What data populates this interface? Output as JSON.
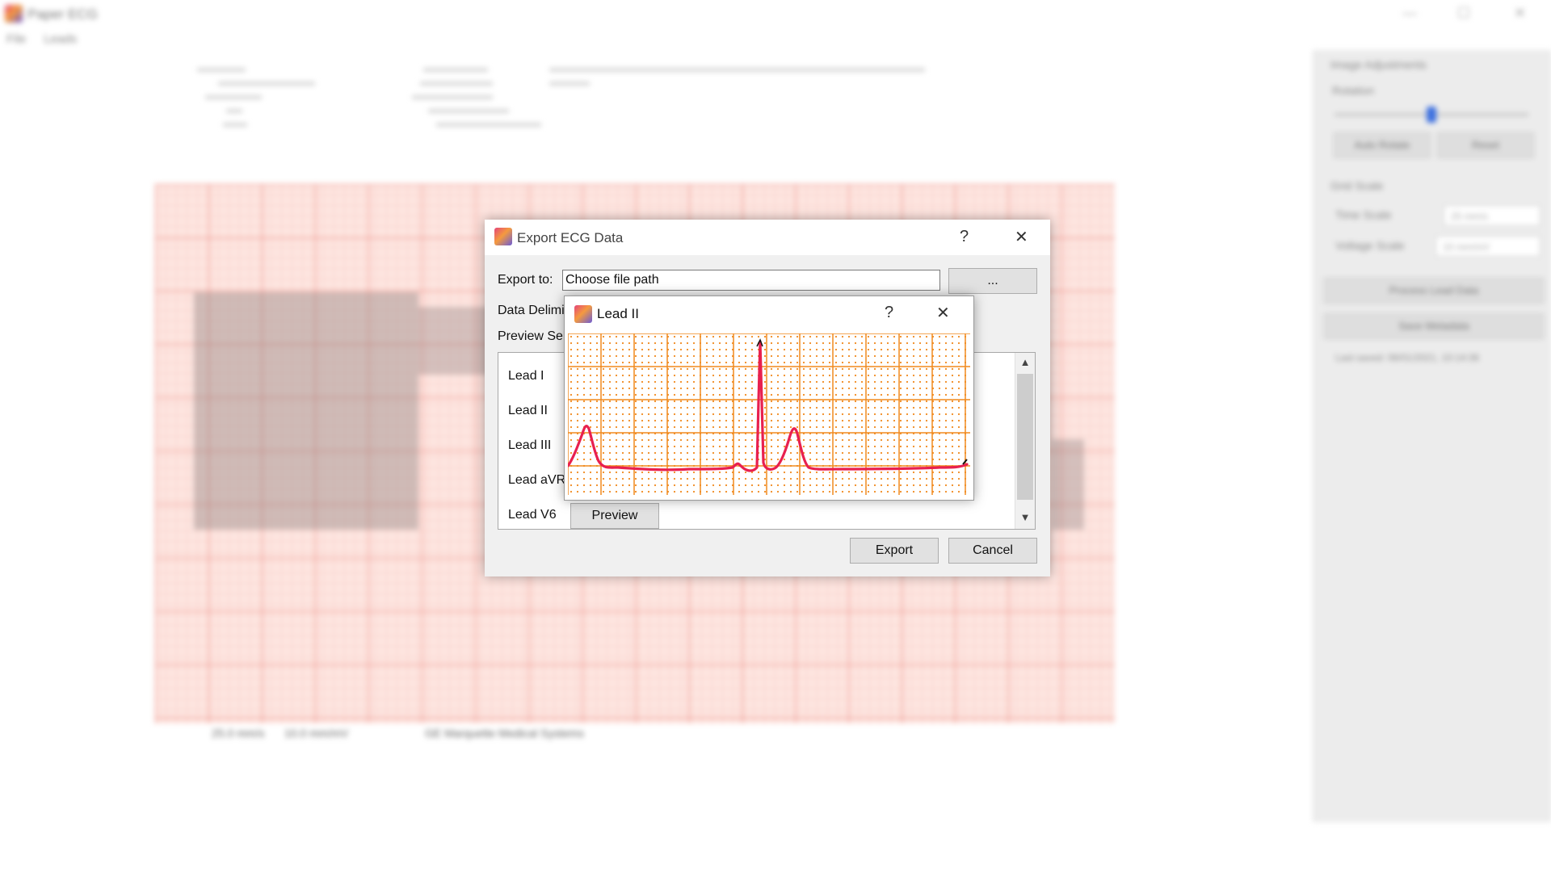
{
  "app": {
    "title": "Paper ECG",
    "menus": [
      "File",
      "Leads"
    ],
    "window_controls": [
      "—",
      "☐",
      "✕"
    ]
  },
  "background": {
    "footer": [
      "25.0 mm/s",
      "10.0 mm/mV",
      "GE Marquette Medical Systems"
    ]
  },
  "side_panel": {
    "section_title": "Image Adjustments",
    "rotation_label": "Rotation",
    "auto_rotate": "Auto Rotate",
    "reset": "Reset",
    "grid_scale_label": "Grid Scale",
    "time_scale_label": "Time Scale",
    "time_scale_value": "25 mm/s",
    "voltage_scale_label": "Voltage Scale",
    "voltage_scale_value": "10 mm/mV",
    "process_button": "Process Lead Data",
    "save_metadata_button": "Save Metadata",
    "last_saved": "Last saved: 06/01/2021, 10:14:36"
  },
  "export_dialog": {
    "title": "Export ECG Data",
    "help_glyph": "?",
    "close_glyph": "✕",
    "export_to_label": "Export to:",
    "path_placeholder": "Choose file path",
    "browse_label": "...",
    "delimiter_label": "Data Delimiter:",
    "preview_label": "Preview Selection:",
    "leads": [
      "Lead I",
      "Lead II",
      "Lead III",
      "Lead aVR",
      "Lead V6"
    ],
    "preview_button": "Preview",
    "export_button": "Export",
    "cancel_button": "Cancel"
  },
  "preview_dialog": {
    "title": "Lead II",
    "help_glyph": "?",
    "close_glyph": "✕",
    "grid_color": "#f08a1e",
    "trace_color": "#e8204f"
  }
}
